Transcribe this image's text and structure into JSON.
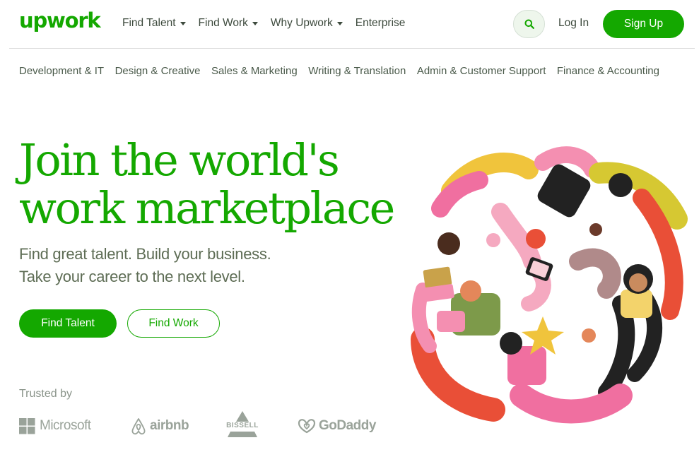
{
  "header": {
    "logo": "upwork",
    "nav": [
      {
        "label": "Find Talent",
        "dropdown": true
      },
      {
        "label": "Find Work",
        "dropdown": true
      },
      {
        "label": "Why Upwork",
        "dropdown": true
      },
      {
        "label": "Enterprise",
        "dropdown": false
      }
    ],
    "search_icon": "search-icon",
    "login": "Log In",
    "signup": "Sign Up"
  },
  "categories": [
    "Development & IT",
    "Design & Creative",
    "Sales & Marketing",
    "Writing & Translation",
    "Admin & Customer Support",
    "Finance & Accounting"
  ],
  "hero": {
    "headline_line1": "Join the world's",
    "headline_line2": "work marketplace",
    "sub_line1": "Find great talent. Build your business.",
    "sub_line2": "Take your career to the next level.",
    "primary_button": "Find Talent",
    "secondary_button": "Find Work"
  },
  "trusted": {
    "label": "Trusted by",
    "brands": [
      "Microsoft",
      "airbnb",
      "BISSELL",
      "GoDaddy"
    ]
  },
  "colors": {
    "brand_green": "#14a800",
    "text_gray": "#5e6d55",
    "logo_gray": "#9aa39a"
  }
}
